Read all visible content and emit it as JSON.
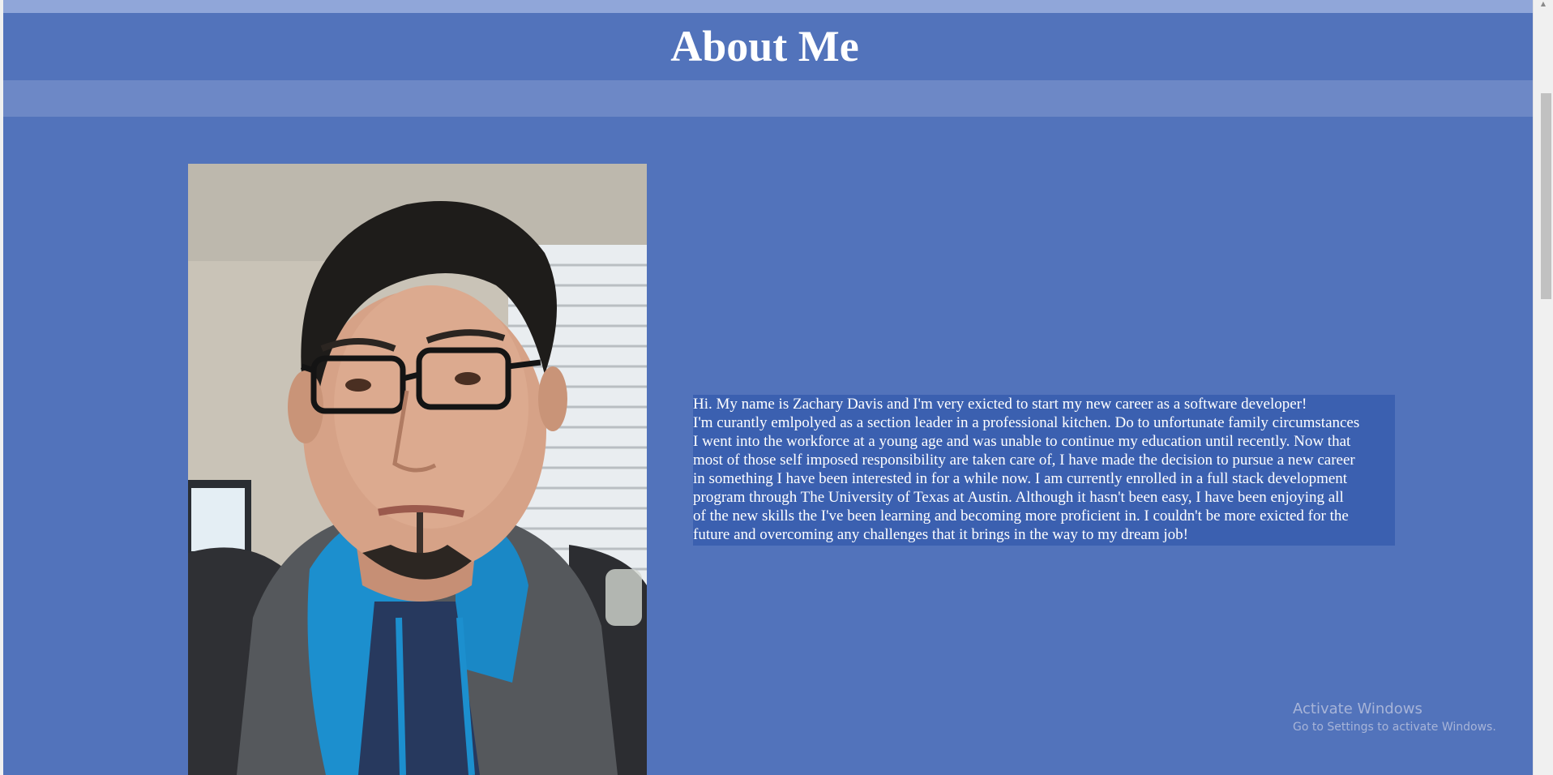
{
  "header": {
    "title": "About Me"
  },
  "bio": {
    "lines": [
      "Hi. My name is Zachary Davis and I'm very exicted to start my new career as a software developer!",
      "I'm curantly emlpolyed as a section leader in a professional kitchen. Do to unfortunate family circumstances",
      "I went into the workforce at a young age and was unable to continue my education until recently. Now that",
      "most of those self imposed responsibility are taken care of, I have made the decision to pursue a new career",
      "in something I have been interested in for a while now. I am currently enrolled in a full stack development",
      "program through The University of Texas at Austin. Although it hasn't been easy, I have been enjoying all",
      "of the new skills the I've been learning and becoming more proficient in. I couldn't be more exicted for the",
      "future and overcoming any challenges that it brings in the way to my dream job!"
    ]
  },
  "watermark": {
    "title": "Activate Windows",
    "subtitle": "Go to Settings to activate Windows."
  },
  "colors": {
    "page_background": "#5273bb",
    "nav_band": "#6d88c6",
    "top_strip": "#90a6d9",
    "bio_highlight": "#3b60b0",
    "text": "#ffffff"
  }
}
